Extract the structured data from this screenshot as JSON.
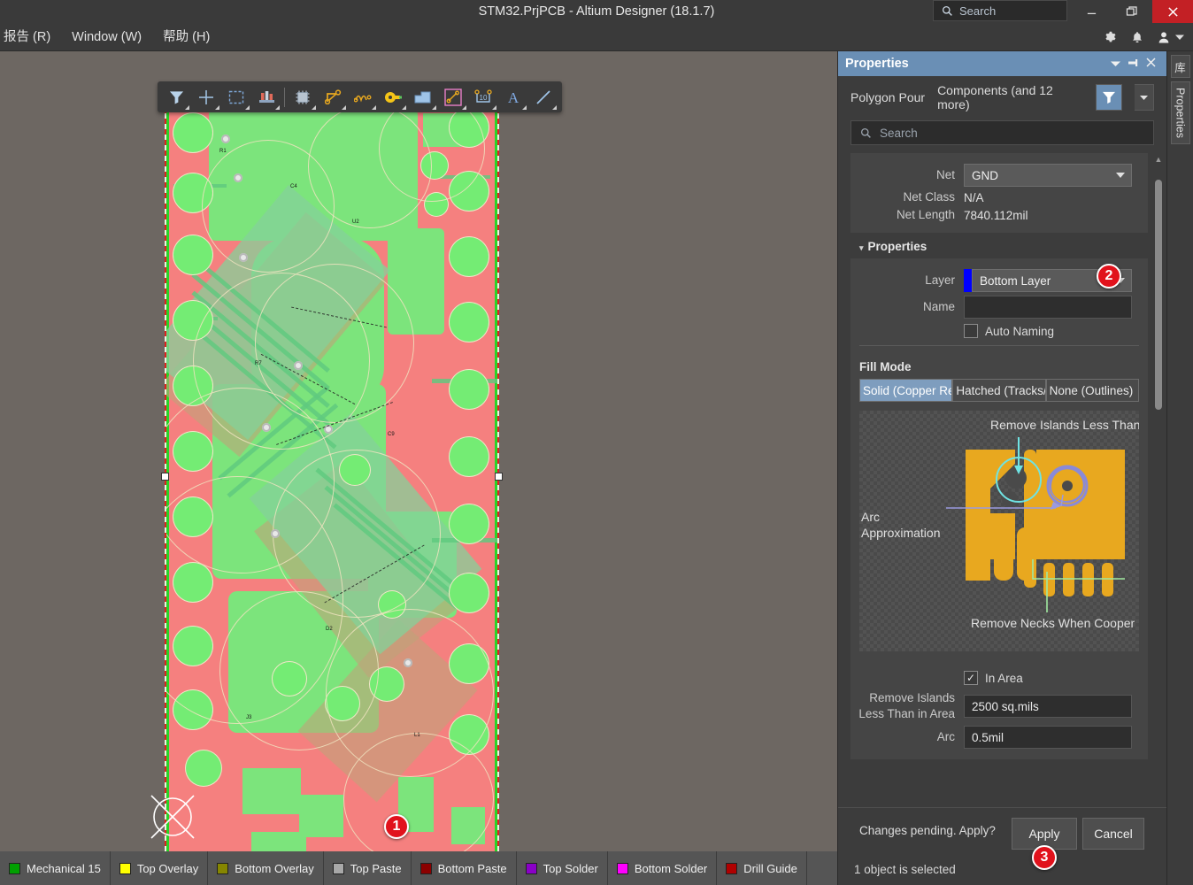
{
  "titlebar": {
    "title": "STM32.PrjPCB - Altium Designer (18.1.7)",
    "search_placeholder": "Search",
    "minimize": "–",
    "maximize": "❐",
    "close": "✕"
  },
  "menubar": {
    "items": [
      {
        "label": "报告 (R)",
        "mnemonic": "R"
      },
      {
        "label": "Window (W)",
        "mnemonic": "W"
      },
      {
        "label": "帮助 (H)",
        "mnemonic": "H"
      }
    ],
    "right_icons": [
      "gear-icon",
      "bell-icon",
      "user-icon",
      "chevron-down-icon"
    ]
  },
  "pcb_toolbar": {
    "tools": [
      {
        "name": "filter-icon",
        "glyph": "▼"
      },
      {
        "name": "crosshair-icon",
        "glyph": "+"
      },
      {
        "name": "selection-box-icon",
        "glyph": "⬚"
      },
      {
        "name": "layer-stack-icon",
        "glyph": "☰"
      },
      {
        "name": "component-icon",
        "glyph": "▣"
      },
      {
        "name": "route-track-icon",
        "glyph": "↗"
      },
      {
        "name": "differential-pair-icon",
        "glyph": "∿"
      },
      {
        "name": "via-pad-icon",
        "glyph": "⚷"
      },
      {
        "name": "polygon-pour-icon",
        "glyph": "◰"
      },
      {
        "name": "dimension-icon",
        "glyph": "⤡"
      },
      {
        "name": "coordinate-icon",
        "glyph": "10"
      },
      {
        "name": "text-string-icon",
        "glyph": "A"
      },
      {
        "name": "line-icon",
        "glyph": "╱"
      }
    ]
  },
  "canvas": {
    "markers": [
      {
        "id": "1",
        "label": "1"
      }
    ],
    "cursor": "crosshair-with-circle"
  },
  "layerbar": {
    "tabs": [
      {
        "label": "Mechanical 15",
        "color": "#00a000"
      },
      {
        "label": "Top Overlay",
        "color": "#ffff00"
      },
      {
        "label": "Bottom Overlay",
        "color": "#868600"
      },
      {
        "label": "Top Paste",
        "color": "#a8a8a8"
      },
      {
        "label": "Bottom Paste",
        "color": "#8b0000"
      },
      {
        "label": "Top Solder",
        "color": "#8a00c8"
      },
      {
        "label": "Bottom Solder",
        "color": "#ff00ff"
      },
      {
        "label": "Drill Guide",
        "color": "#b00000"
      }
    ]
  },
  "panel": {
    "header": {
      "title": "Properties",
      "buttons": [
        "chevron-down-icon",
        "pin-icon",
        "close-icon"
      ]
    },
    "object_line": {
      "primary": "Polygon Pour",
      "secondary": "Components (and 12 more)",
      "filter_icon": "filter-icon",
      "filter_dropdown_icon": "chevron-down-icon"
    },
    "search": {
      "placeholder": "Search",
      "icon": "search-icon"
    },
    "net_section": {
      "net_label": "Net",
      "net_value": "GND",
      "net_class_label": "Net Class",
      "net_class_value": "N/A",
      "net_length_label": "Net Length",
      "net_length_value": "7840.112mil"
    },
    "properties_section": {
      "title": "Properties",
      "layer_label": "Layer",
      "layer_value": "Bottom Layer",
      "layer_color": "#0000ff",
      "name_label": "Name",
      "name_value": "",
      "auto_naming_label": "Auto Naming",
      "auto_naming_checked": false,
      "marker": "2"
    },
    "fill_mode": {
      "title": "Fill Mode",
      "options": [
        {
          "label": "Solid (Copper Re",
          "selected": true
        },
        {
          "label": "Hatched (Tracks/",
          "selected": false
        },
        {
          "label": "None (Outlines)",
          "selected": false
        }
      ]
    },
    "diagram": {
      "label_top": "Remove Islands Less Than",
      "label_left_1": "Arc",
      "label_left_2": "Approximation",
      "label_bottom": "Remove Necks When Cooper "
    },
    "area_section": {
      "in_area_label": "In Area",
      "in_area_checked": true,
      "remove_islands_label_1": "Remove Islands",
      "remove_islands_label_2": "Less Than in Area",
      "remove_islands_value": "2500 sq.mils",
      "arc_label": "Arc",
      "arc_value": "0.5mil"
    },
    "footer": {
      "pending_text": "Changes pending. Apply?",
      "apply_label": "Apply",
      "cancel_label": "Cancel",
      "marker": "3",
      "status": "1 object is selected"
    }
  },
  "right_dock": {
    "tabs": [
      {
        "label": "库"
      },
      {
        "label": "Properties"
      }
    ]
  }
}
